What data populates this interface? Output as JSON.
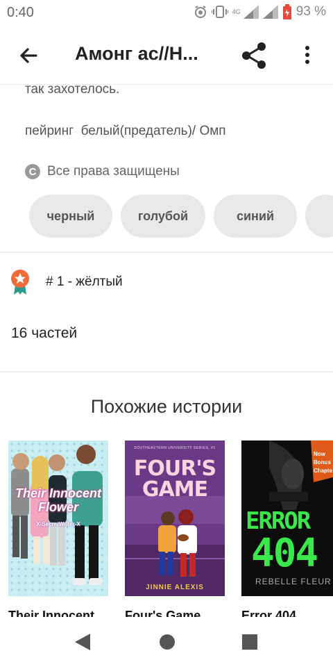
{
  "status_bar": {
    "time": "0:40",
    "network": "4G",
    "battery_percent": "93 %"
  },
  "app_bar": {
    "title": "Амонг ас//Н...",
    "icons": [
      "back-arrow-icon",
      "share-icon",
      "more-vertical-icon"
    ]
  },
  "description": {
    "line1": "так захотелось.",
    "line2": "пейринг  белый(предатель)/ Омп"
  },
  "copyright": {
    "icon": "copyright-icon",
    "text": "Все права защищены"
  },
  "tags": [
    "черный",
    "голубой",
    "синий"
  ],
  "ranking": {
    "icon": "award-badge-icon",
    "text": "# 1 - жёлтый",
    "color": "#f26b3a"
  },
  "parts_count": "16 частей",
  "similar": {
    "title": "Похожие истории",
    "books": [
      {
        "title": "Their Innocent",
        "cover_title": "Their Innocent Flower",
        "cover_author": "X-SecretWriter-X"
      },
      {
        "title": "Four's Game",
        "cover_series": "SOUTHEASTERN UNIVERSITY SERIES, #1",
        "cover_title": "FOUR'S GAME",
        "cover_author": "JINNIE ALEXIS"
      },
      {
        "title": "Error 404",
        "cover_title_line1": "ERROR",
        "cover_title_line2": "404",
        "cover_author": "REBELLE FLEUR",
        "cover_badge": "Now Bonus Chapte"
      }
    ]
  },
  "nav_bar": {
    "icons": [
      "nav-back-icon",
      "nav-home-icon",
      "nav-recents-icon"
    ]
  }
}
